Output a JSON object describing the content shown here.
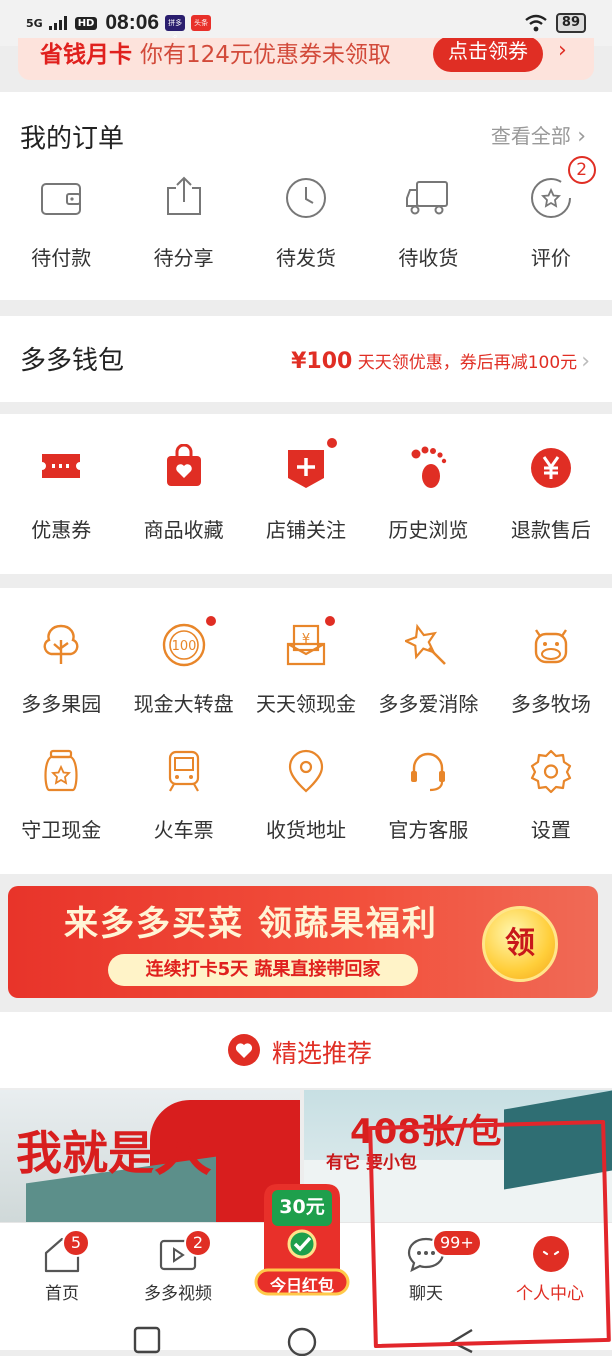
{
  "status_bar": {
    "signal": "5G",
    "hd": "HD",
    "time": "08:06",
    "app1": "拼多多",
    "app2": "头条",
    "battery": "89"
  },
  "promo": {
    "title": "省钱月卡",
    "text": "你有124元优惠券未领取",
    "button": "点击领券"
  },
  "orders": {
    "title": "我的订单",
    "view_all": "查看全部",
    "items": [
      {
        "label": "待付款",
        "icon": "wallet-icon"
      },
      {
        "label": "待分享",
        "icon": "share-icon"
      },
      {
        "label": "待发货",
        "icon": "clock-icon"
      },
      {
        "label": "待收货",
        "icon": "truck-icon"
      },
      {
        "label": "评价",
        "icon": "review-star-icon",
        "badge": "2"
      }
    ]
  },
  "wallet": {
    "title": "多多钱包",
    "amount": "¥100",
    "promo_text": "天天领优惠，券后再减100元"
  },
  "quick": {
    "items": [
      {
        "label": "优惠券",
        "icon": "coupon-icon"
      },
      {
        "label": "商品收藏",
        "icon": "bag-heart-icon"
      },
      {
        "label": "店铺关注",
        "icon": "shop-plus-icon",
        "dot": true
      },
      {
        "label": "历史浏览",
        "icon": "footprint-icon"
      },
      {
        "label": "退款售后",
        "icon": "yen-circle-icon"
      }
    ]
  },
  "services": {
    "row1": [
      {
        "label": "多多果园",
        "icon": "tree-icon"
      },
      {
        "label": "现金大转盘",
        "icon": "wheel-100-icon",
        "dot": true
      },
      {
        "label": "天天领现金",
        "icon": "cash-envelope-icon",
        "dot": true
      },
      {
        "label": "多多爱消除",
        "icon": "star-wand-icon"
      },
      {
        "label": "多多牧场",
        "icon": "cow-icon"
      }
    ],
    "row2": [
      {
        "label": "守卫现金",
        "icon": "jar-star-icon"
      },
      {
        "label": "火车票",
        "icon": "train-icon"
      },
      {
        "label": "收货地址",
        "icon": "location-icon"
      },
      {
        "label": "官方客服",
        "icon": "headset-icon"
      },
      {
        "label": "设置",
        "icon": "gear-icon"
      }
    ]
  },
  "banner": {
    "title": "来多多买菜 领蔬果福利",
    "subtitle": "连续打卡5天 蔬果直接带回家",
    "button": "领"
  },
  "recommend": {
    "title": "精选推荐"
  },
  "products": [
    {
      "headline_a": "我就是",
      "headline_b": "大"
    },
    {
      "headline": "408张/包",
      "sub": "有它 要小包"
    }
  ],
  "tabbar": {
    "items": [
      {
        "label": "首页",
        "badge": "5",
        "icon": "home-icon"
      },
      {
        "label": "多多视频",
        "badge": "2",
        "icon": "video-icon"
      },
      {
        "label": "今日红包",
        "amount": "30元",
        "icon": "red-packet-icon"
      },
      {
        "label": "聊天",
        "badge": "99+",
        "icon": "chat-icon"
      },
      {
        "label": "个人中心",
        "icon": "profile-icon"
      }
    ]
  },
  "colors": {
    "accent": "#e02e24",
    "icon_orange": "#e8862a"
  }
}
